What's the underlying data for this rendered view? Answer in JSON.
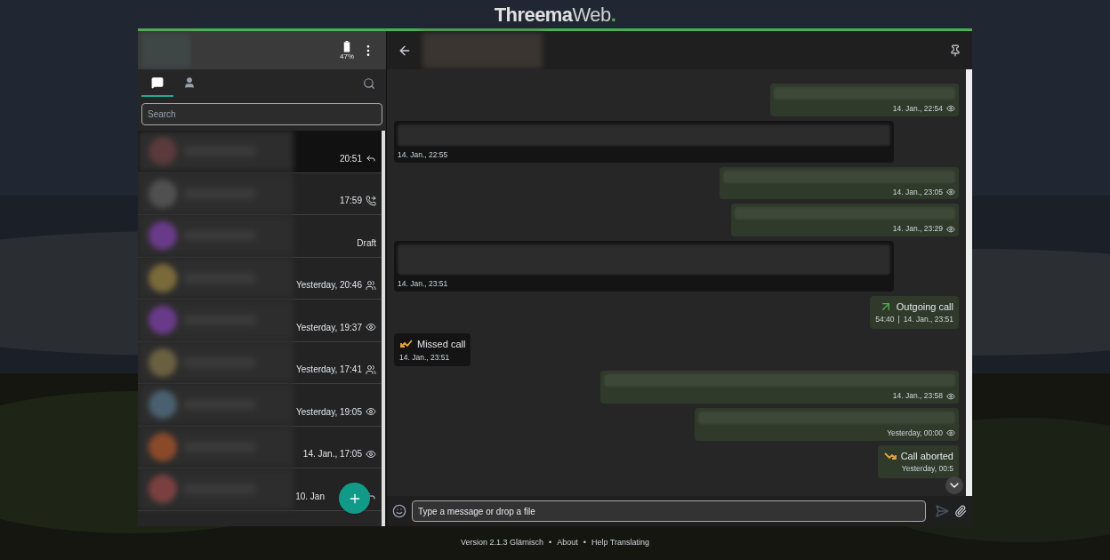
{
  "app_title": {
    "brand": "Threema",
    "suffix": "Web",
    "dot": "."
  },
  "account": {
    "battery": "47%"
  },
  "tabs": [
    {
      "kind": "chats",
      "selected": true
    },
    {
      "kind": "contacts",
      "selected": false
    }
  ],
  "search": {
    "placeholder": "Search"
  },
  "conversations": [
    {
      "time": "20:51",
      "kind": "reply",
      "selected": true
    },
    {
      "time": "17:59",
      "kind": "call",
      "selected": false
    },
    {
      "time": "Draft",
      "kind": "draft",
      "selected": false
    },
    {
      "time": "Yesterday, 20:46",
      "kind": "group",
      "selected": false
    },
    {
      "time": "Yesterday, 19:37",
      "kind": "seen",
      "selected": false
    },
    {
      "time": "Yesterday, 17:41",
      "kind": "group",
      "selected": false
    },
    {
      "time": "Yesterday, 19:05",
      "kind": "seen",
      "selected": false
    },
    {
      "time": "14. Jan., 17:05",
      "kind": "seen",
      "selected": false
    },
    {
      "time": "10. Jan",
      "kind": "reply",
      "selected": false
    }
  ],
  "messages": [
    {
      "kind": "text",
      "outgoing": true,
      "time": "14. Jan., 22:54",
      "seen": true
    },
    {
      "kind": "text",
      "outgoing": false,
      "time": "14. Jan., 22:55"
    },
    {
      "kind": "text",
      "outgoing": true,
      "time": "14. Jan., 23:05",
      "seen": true
    },
    {
      "kind": "text",
      "outgoing": true,
      "time": "14. Jan., 23:29",
      "seen": true
    },
    {
      "kind": "text",
      "outgoing": false,
      "time": "14. Jan., 23:51"
    },
    {
      "kind": "call_out",
      "outgoing": true,
      "label": "Outgoing call",
      "duration": "54:40",
      "separator": "|",
      "time": "14. Jan., 23:51"
    },
    {
      "kind": "call_missed",
      "outgoing": false,
      "label": "Missed call",
      "time": "14. Jan., 23:51"
    },
    {
      "kind": "text",
      "outgoing": true,
      "time": "14. Jan., 23:58",
      "seen": true
    },
    {
      "kind": "text",
      "outgoing": true,
      "time": "Yesterday, 00:00",
      "seen": true
    },
    {
      "kind": "call_aborted",
      "outgoing": true,
      "label": "Call aborted",
      "time": "Yesterday, 00:5"
    }
  ],
  "compose": {
    "placeholder": "Type a message or drop a file"
  },
  "footer": {
    "separator": "•",
    "version": "Version 2.1.3 Glärnisch",
    "links": [
      "About",
      "Help Translating"
    ]
  }
}
